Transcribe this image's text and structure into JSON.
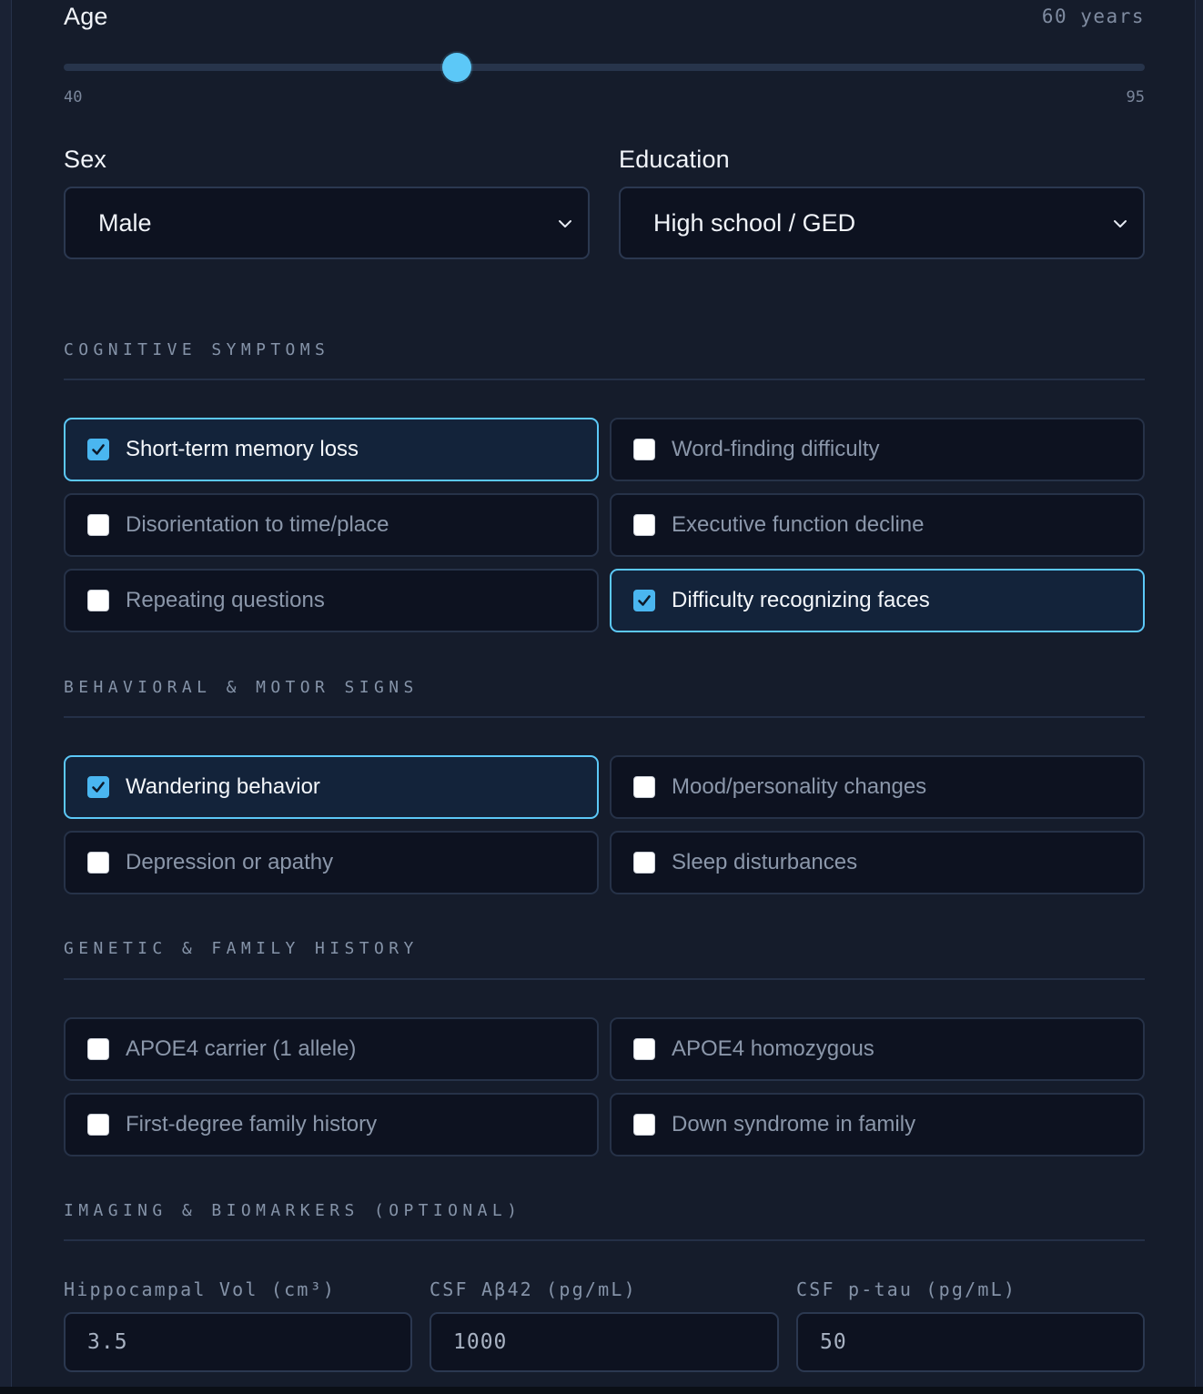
{
  "age": {
    "label": "Age",
    "value_text": "60 years",
    "min_label": "40",
    "max_label": "95",
    "value": 60,
    "min": 40,
    "max": 95
  },
  "sex": {
    "label": "Sex",
    "selected": "Male",
    "icon": "chevron-down-icon"
  },
  "education": {
    "label": "Education",
    "selected": "High school / GED",
    "icon": "chevron-down-icon"
  },
  "sections": {
    "cognitive": {
      "title": "COGNITIVE SYMPTOMS",
      "items": [
        {
          "label": "Short-term memory loss",
          "checked": true
        },
        {
          "label": "Word-finding difficulty",
          "checked": false
        },
        {
          "label": "Disorientation to time/place",
          "checked": false
        },
        {
          "label": "Executive function decline",
          "checked": false
        },
        {
          "label": "Repeating questions",
          "checked": false
        },
        {
          "label": "Difficulty recognizing faces",
          "checked": true
        }
      ]
    },
    "behavioral": {
      "title": "BEHAVIORAL & MOTOR SIGNS",
      "items": [
        {
          "label": "Wandering behavior",
          "checked": true
        },
        {
          "label": "Mood/personality changes",
          "checked": false
        },
        {
          "label": "Depression or apathy",
          "checked": false
        },
        {
          "label": "Sleep disturbances",
          "checked": false
        }
      ]
    },
    "genetic": {
      "title": "GENETIC & FAMILY HISTORY",
      "items": [
        {
          "label": "APOE4 carrier (1 allele)",
          "checked": false
        },
        {
          "label": "APOE4 homozygous",
          "checked": false
        },
        {
          "label": "First-degree family history",
          "checked": false
        },
        {
          "label": "Down syndrome in family",
          "checked": false
        }
      ]
    },
    "imaging": {
      "title": "IMAGING & BIOMARKERS (OPTIONAL)",
      "inputs": [
        {
          "label": "Hippocampal Vol (cm³)",
          "value": "3.5"
        },
        {
          "label": "CSF Aβ42 (pg/mL)",
          "value": "1000"
        },
        {
          "label": "CSF p-tau (pg/mL)",
          "value": "50"
        }
      ]
    }
  },
  "colors": {
    "accent": "#5cc8f7",
    "background": "#151c2b",
    "field_background": "#0d1220"
  }
}
